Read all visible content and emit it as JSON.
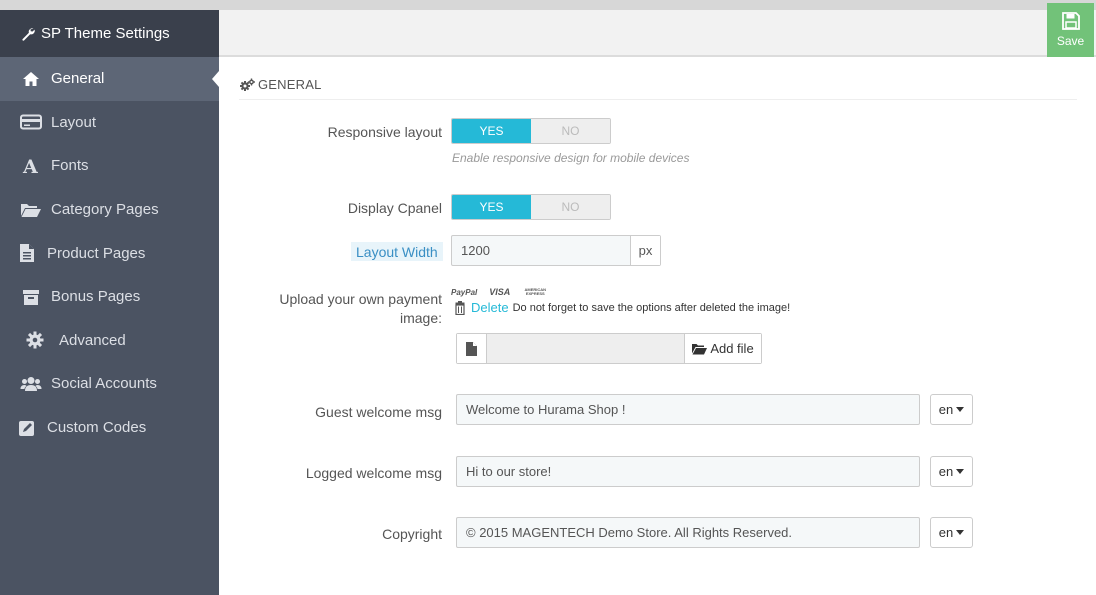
{
  "sidebar": {
    "title": "SP Theme Settings",
    "items": [
      {
        "label": "General",
        "icon": "home-icon"
      },
      {
        "label": "Layout",
        "icon": "credit-card-icon"
      },
      {
        "label": "Fonts",
        "icon": "font-icon"
      },
      {
        "label": "Category Pages",
        "icon": "folder-open-icon"
      },
      {
        "label": "Product Pages",
        "icon": "file-text-icon"
      },
      {
        "label": "Bonus Pages",
        "icon": "archive-icon"
      },
      {
        "label": "Advanced",
        "icon": "gear-icon"
      },
      {
        "label": "Social Accounts",
        "icon": "users-icon"
      },
      {
        "label": "Custom Codes",
        "icon": "edit-icon"
      }
    ]
  },
  "toolbar": {
    "save_label": "Save"
  },
  "panel": {
    "title": "GENERAL"
  },
  "form": {
    "responsive": {
      "label": "Responsive layout",
      "yes": "YES",
      "no": "NO",
      "hint": "Enable responsive design for mobile devices"
    },
    "cpanel": {
      "label": "Display Cpanel",
      "yes": "YES",
      "no": "NO"
    },
    "layout_width": {
      "label": "Layout Width",
      "value": "1200",
      "unit": "px"
    },
    "payment": {
      "label": "Upload your own payment image:",
      "logos": [
        "PayPal",
        "VISA",
        "AMERICAN EXPRESS"
      ],
      "delete_label": "Delete",
      "delete_note": "Do not forget to save the options after deleted the image!",
      "add_file_label": "Add file"
    },
    "guest_msg": {
      "label": "Guest welcome msg",
      "value": "Welcome to Hurama Shop !",
      "lang": "en"
    },
    "logged_msg": {
      "label": "Logged welcome msg",
      "value": "Hi to our store!",
      "lang": "en"
    },
    "copyright": {
      "label": "Copyright",
      "value": "© 2015 MAGENTECH Demo Store. All Rights Reserved.",
      "lang": "en"
    }
  },
  "colors": {
    "accent": "#25b9d7",
    "save": "#72c279",
    "sidebar": "#4b5362",
    "sidebar_header": "#3a404c"
  }
}
